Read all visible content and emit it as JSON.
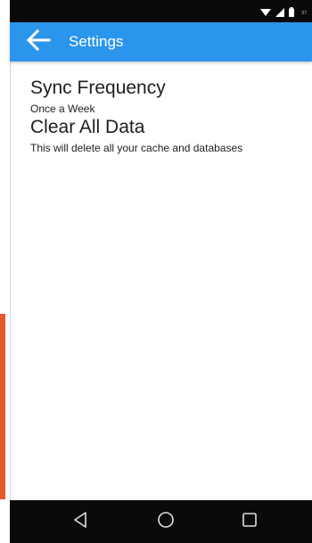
{
  "status_bar": {
    "time_text": "57"
  },
  "app_bar": {
    "title": "Settings",
    "color": "#2b95ec"
  },
  "preferences": [
    {
      "title": "Sync Frequency",
      "summary": "Once a Week"
    },
    {
      "title": "Clear All Data",
      "summary": "This will delete all your cache and databases"
    }
  ],
  "icons": {
    "back": "arrow-left-icon",
    "wifi": "wifi-icon",
    "signal": "cell-signal-icon",
    "battery": "battery-icon",
    "nav_back": "triangle-back-icon",
    "nav_home": "circle-home-icon",
    "nav_recents": "square-recents-icon"
  }
}
